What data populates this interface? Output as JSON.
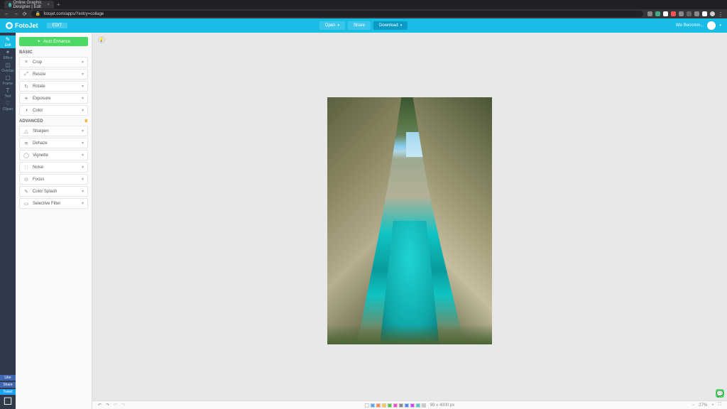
{
  "browser": {
    "tab_title": "Online Graphic Designer | Edit",
    "url": "fotojet.com/apps/?entry=collage",
    "new_tab": "+",
    "close": "×"
  },
  "header": {
    "logo": "FotoJet",
    "mode": "EDIT",
    "open": "Open",
    "share": "Share",
    "download": "Download",
    "user": "We Recomm..."
  },
  "sidenav": [
    {
      "label": "Edit",
      "icon": "✎"
    },
    {
      "label": "Effect",
      "icon": "✦"
    },
    {
      "label": "Overlay",
      "icon": "◫"
    },
    {
      "label": "Frame",
      "icon": "▢"
    },
    {
      "label": "Text",
      "icon": "T"
    },
    {
      "label": "Clipart",
      "icon": "♡"
    }
  ],
  "social": {
    "like": "Like",
    "share": "Share",
    "tweet": "Tweet"
  },
  "panel": {
    "auto": "Auto Enhance",
    "basic_hdr": "BASIC",
    "advanced_hdr": "ADVANCED",
    "crown": "♛",
    "basic": [
      {
        "label": "Crop",
        "icon": "⌗"
      },
      {
        "label": "Resize",
        "icon": "⤢"
      },
      {
        "label": "Rotate",
        "icon": "↻"
      },
      {
        "label": "Exposure",
        "icon": "☀"
      },
      {
        "label": "Color",
        "icon": "◑"
      }
    ],
    "advanced": [
      {
        "label": "Sharpen",
        "icon": "△"
      },
      {
        "label": "Dehaze",
        "icon": "≋"
      },
      {
        "label": "Vignette",
        "icon": "◯"
      },
      {
        "label": "Noise",
        "icon": "∷"
      },
      {
        "label": "Focus",
        "icon": "⊙"
      },
      {
        "label": "Color Splash",
        "icon": "✎"
      },
      {
        "label": "Selective Filter",
        "icon": "▭"
      }
    ]
  },
  "bottombar": {
    "undo": "↶",
    "redo": "↷",
    "dims": "99 x 4000 px",
    "zoom": "27%",
    "minus": "−",
    "plus": "+",
    "fit": "⛶"
  }
}
